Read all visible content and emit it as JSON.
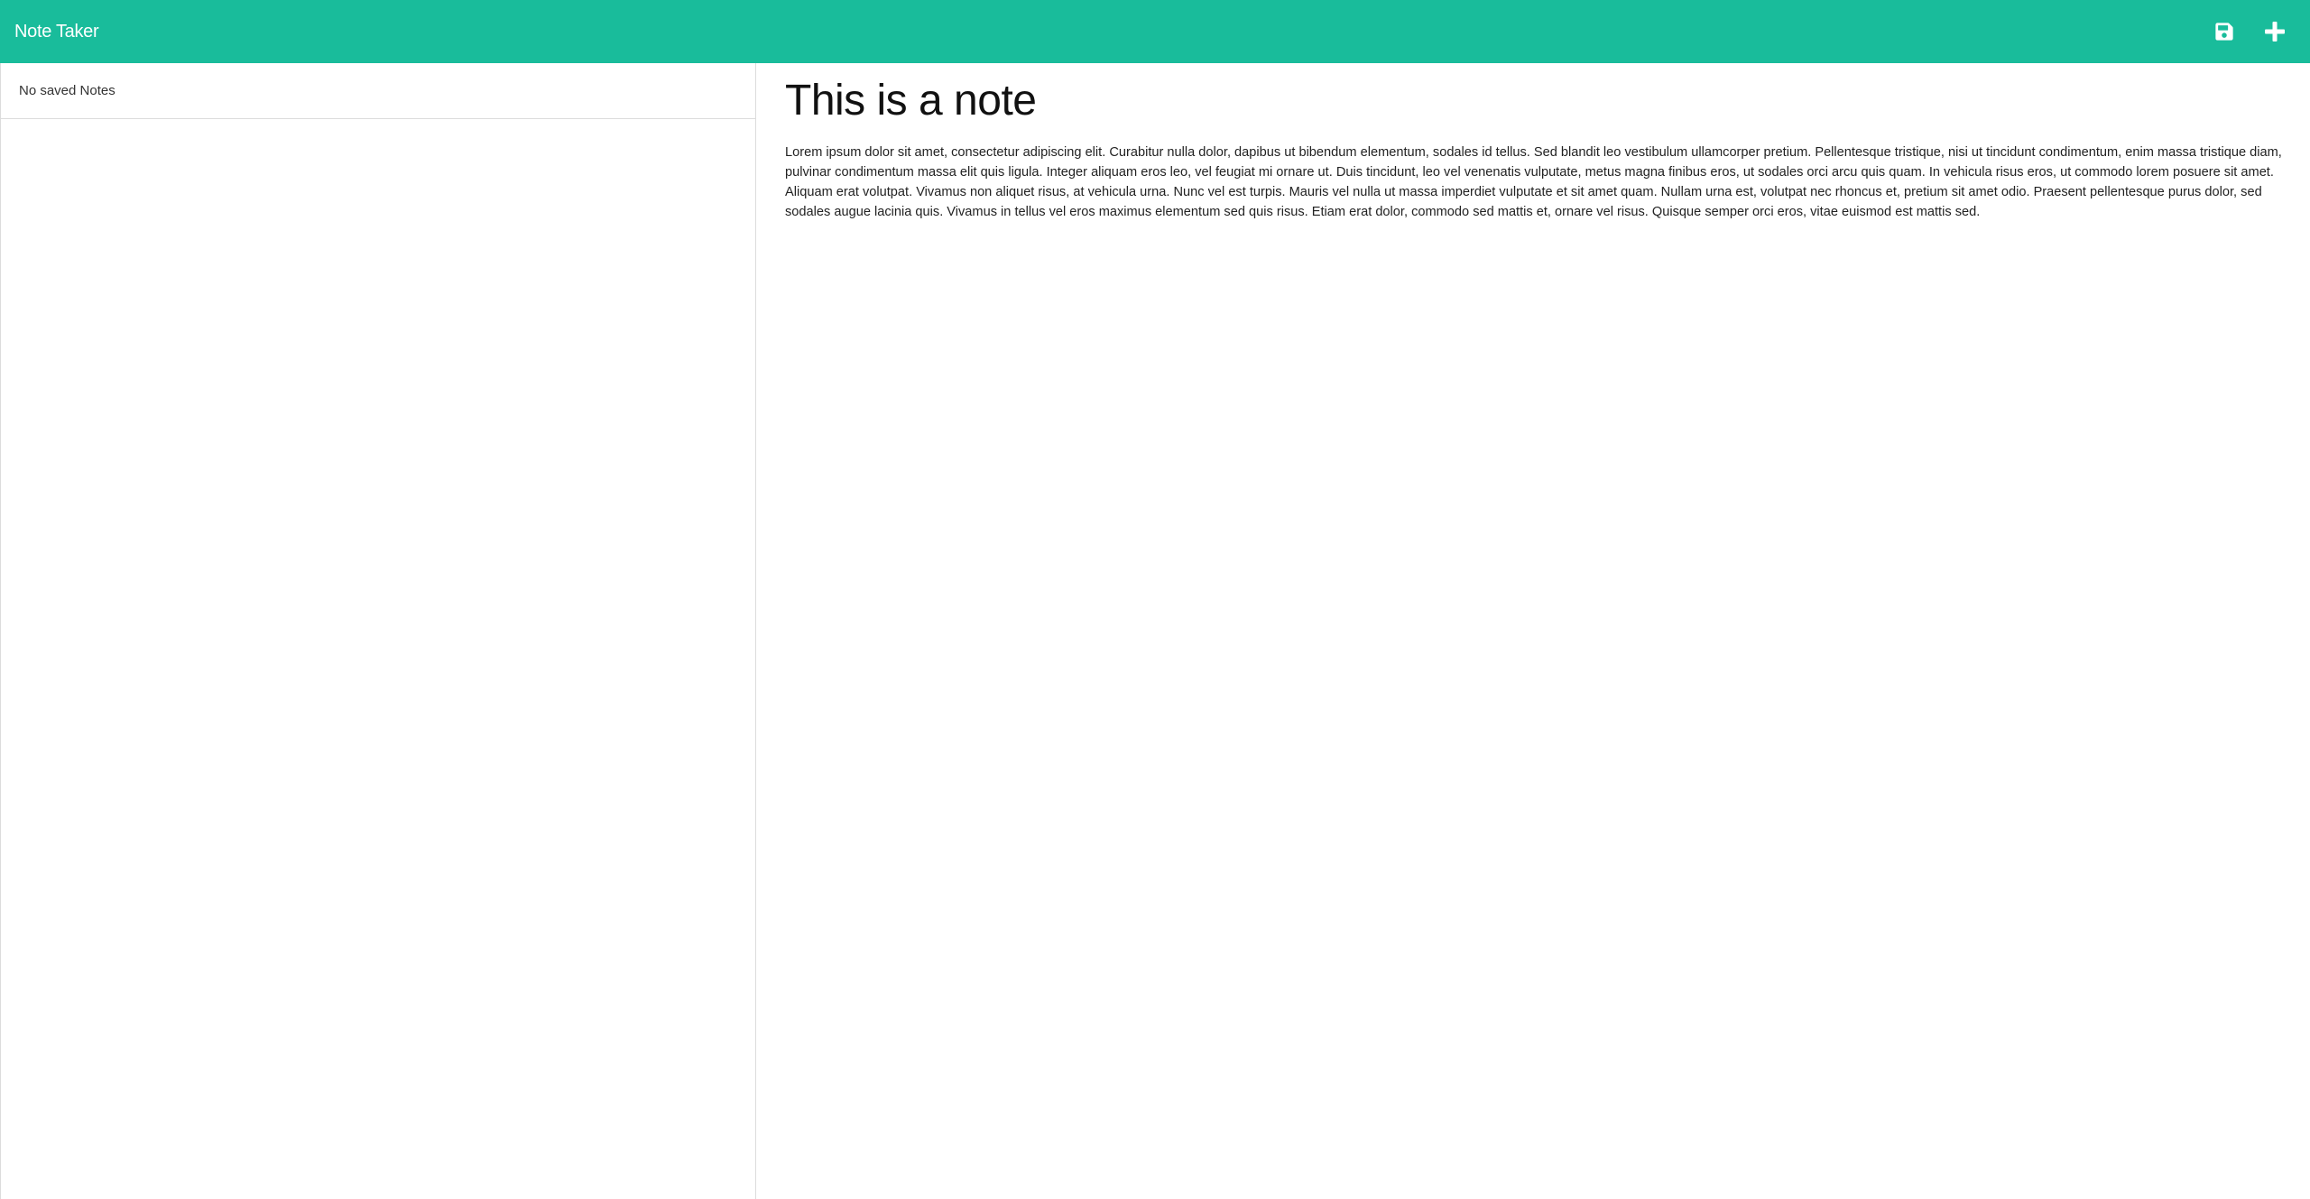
{
  "app": {
    "title": "Note Taker",
    "accent_color": "#19bc9b"
  },
  "toolbar": {
    "save_icon": "floppy-disk-save-icon",
    "new_icon": "plus-new-note-icon"
  },
  "sidebar": {
    "empty_message": "No saved Notes"
  },
  "note": {
    "title": "This is a note",
    "body": "Lorem ipsum dolor sit amet, consectetur adipiscing elit. Curabitur nulla dolor, dapibus ut bibendum elementum, sodales id tellus. Sed blandit leo vestibulum ullamcorper pretium. Pellentesque tristique, nisi ut tincidunt condimentum, enim massa tristique diam, pulvinar condimentum massa elit quis ligula. Integer aliquam eros leo, vel feugiat mi ornare ut. Duis tincidunt, leo vel venenatis vulputate, metus magna finibus eros, ut sodales orci arcu quis quam. In vehicula risus eros, ut commodo lorem posuere sit amet. Aliquam erat volutpat. Vivamus non aliquet risus, at vehicula urna. Nunc vel est turpis. Mauris vel nulla ut massa imperdiet vulputate et sit amet quam. Nullam urna est, volutpat nec rhoncus et, pretium sit amet odio. Praesent pellentesque purus dolor, sed sodales augue lacinia quis. Vivamus in tellus vel eros maximus elementum sed quis risus. Etiam erat dolor, commodo sed mattis et, ornare vel risus. Quisque semper orci eros, vitae euismod est mattis sed."
  }
}
